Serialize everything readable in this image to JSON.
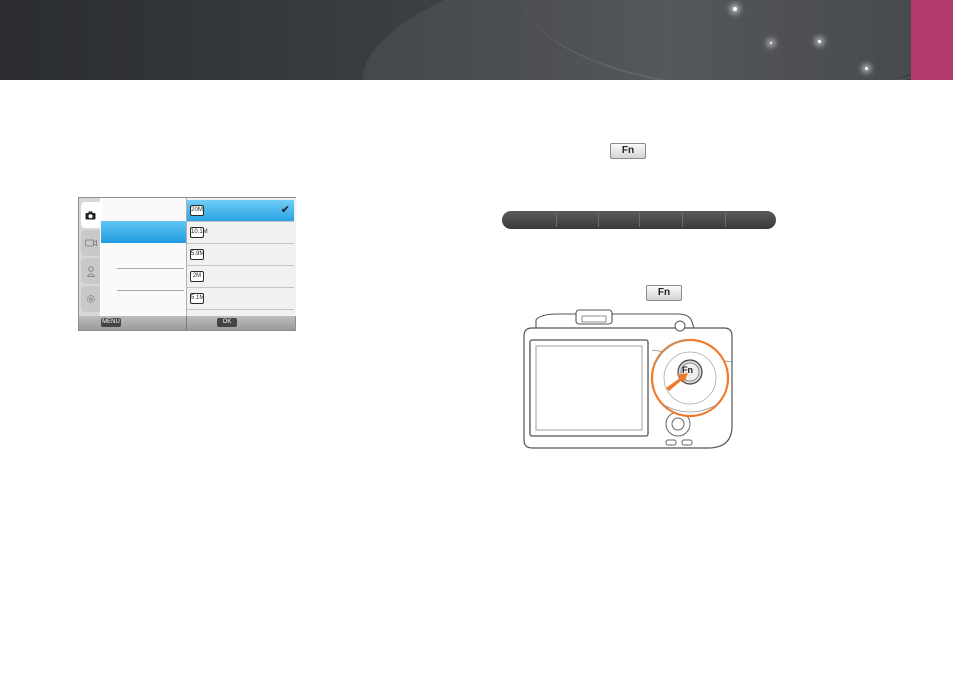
{
  "colors": {
    "accent_tab": "#b33a6b",
    "highlight": "#2aa3e3",
    "callout": "#f07a2a"
  },
  "lcd_menu": {
    "sidebar_tabs": [
      "camera-icon",
      "video-icon",
      "user-icon",
      "settings-icon"
    ],
    "resolution_options": [
      {
        "label": "20M",
        "selected": true
      },
      {
        "label": "10.1M",
        "selected": false
      },
      {
        "label": "5.9M",
        "selected": false
      },
      {
        "label": "2M",
        "selected": false
      },
      {
        "label": "5.1M",
        "selected": false
      }
    ],
    "bottom_buttons": {
      "menu": "MENU",
      "ok": "OK"
    }
  },
  "fn_button_label": "Fn",
  "camera_fn_label": "Fn"
}
